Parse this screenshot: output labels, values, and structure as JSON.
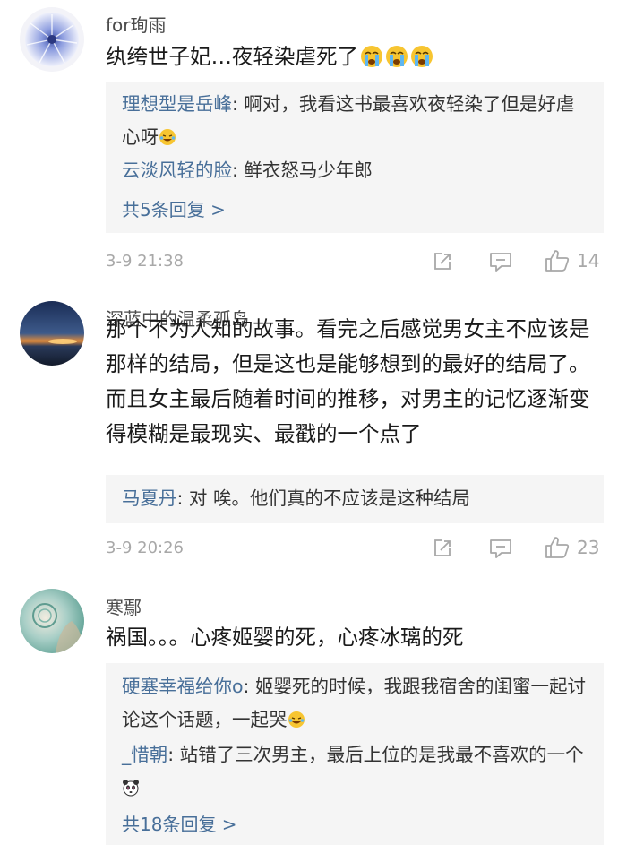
{
  "comments": [
    {
      "author": "for珣雨",
      "text": "纨绔世子妃…夜轻染虐死了",
      "emoji": "crying-emoji",
      "replies": [
        {
          "name": "理想型是岳峰",
          "text": ": 啊对，我看这书最喜欢夜轻染了但是好虐心呀",
          "emoji": "laughing-tears-emoji"
        },
        {
          "name": "云淡风轻的脸",
          "text": ": 鲜衣怒马少年郎"
        }
      ],
      "more_label": "共5条回复 >",
      "time": "3-9 21:38",
      "likes": "14"
    },
    {
      "author": "深蓝中的温柔孤岛",
      "text": "那个不为人知的故事。看完之后感觉男女主不应该是那样的结局，但是这也是能够想到的最好的结局了。而且女主最后随着时间的推移，对男主的记忆逐渐变得模糊是最现实、最戳的一个点了",
      "replies": [
        {
          "name": "马夏丹",
          "text": ": 对 唉。他们真的不应该是这种结局"
        }
      ],
      "time": "3-9 20:26",
      "likes": "23"
    },
    {
      "author": "寒鄢",
      "text": "祸国。。。心疼姬婴的死，心疼冰璃的死",
      "replies": [
        {
          "name": "硬塞幸福给你o",
          "text": ": 姬婴死的时候，我跟我宿舍的闺蜜一起讨论这个话题，一起哭",
          "emoji": "laughing-tears-emoji"
        },
        {
          "name": "_惜朝",
          "text": ": 站错了三次男主，最后上位的是我最不喜欢的一个",
          "emoji": "panda-emoji"
        }
      ],
      "more_label": "共18条回复 >"
    }
  ],
  "colors": {
    "link": "#486f99",
    "meta": "#a8a8a8",
    "reply_bg": "#f5f5f5"
  }
}
